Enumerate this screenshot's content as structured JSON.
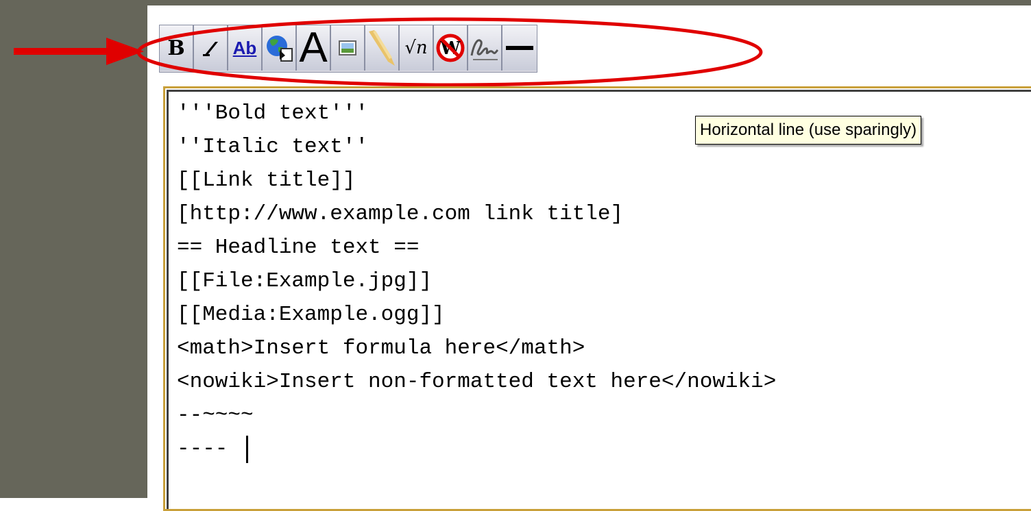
{
  "colors": {
    "frame": "#66665a",
    "highlight": "#e00000",
    "toolbar_border": "#8a8fa3",
    "editor_border": "#c9a03a",
    "tooltip_bg": "#ffffe1"
  },
  "toolbar": {
    "buttons": [
      {
        "icon": "bold-icon",
        "label": "B"
      },
      {
        "icon": "italic-icon",
        "label": ""
      },
      {
        "icon": "internal-link-icon",
        "label": "Ab"
      },
      {
        "icon": "external-link-icon",
        "label": ""
      },
      {
        "icon": "headline-icon",
        "label": "A"
      },
      {
        "icon": "embedded-file-icon",
        "label": ""
      },
      {
        "icon": "media-link-icon",
        "label": ""
      },
      {
        "icon": "math-formula-icon",
        "label": "√n"
      },
      {
        "icon": "nowiki-icon",
        "label": "W"
      },
      {
        "icon": "signature-icon",
        "label": ""
      },
      {
        "icon": "horizontal-line-icon",
        "label": ""
      }
    ]
  },
  "tooltip": {
    "text": "Horizontal line (use sparingly)"
  },
  "editor": {
    "lines": [
      "'''Bold text'''",
      "''Italic text''",
      "[[Link title]]",
      "[http://www.example.com link title]",
      "== Headline text ==",
      "[[File:Example.jpg]]",
      "[[Media:Example.ogg]]",
      "<math>Insert formula here</math>",
      "<nowiki>Insert non-formatted text here</nowiki>",
      "--~~~~",
      "----"
    ]
  }
}
